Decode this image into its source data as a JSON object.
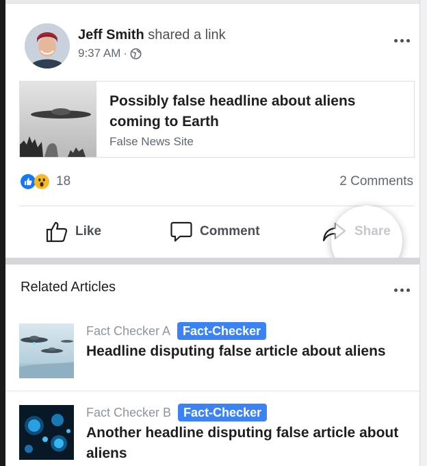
{
  "post": {
    "author": "Jeff Smith",
    "action_text": "shared a link",
    "time": "9:37 AM",
    "separator": "·",
    "privacy_icon": "globe-icon",
    "link": {
      "title": "Possibly false headline about aliens coming to Earth",
      "source": "False News Site"
    },
    "reactions": {
      "icons": [
        "like-reaction-icon",
        "wow-reaction-icon"
      ],
      "count": "18"
    },
    "comments_text": "2 Comments",
    "actions": {
      "like": "Like",
      "comment": "Comment",
      "share": "Share"
    }
  },
  "related": {
    "title": "Related Articles",
    "articles": [
      {
        "source": "Fact Checker A",
        "badge": "Fact-Checker",
        "headline": "Headline disputing false article about aliens"
      },
      {
        "source": "Fact Checker B",
        "badge": "Fact-Checker",
        "headline": "Another headline disputing false article about aliens"
      }
    ]
  },
  "colors": {
    "badge": "#3b82f5",
    "like_blue": "#1877f2",
    "wow_yellow": "#f7b928",
    "muted_text": "#606770"
  }
}
